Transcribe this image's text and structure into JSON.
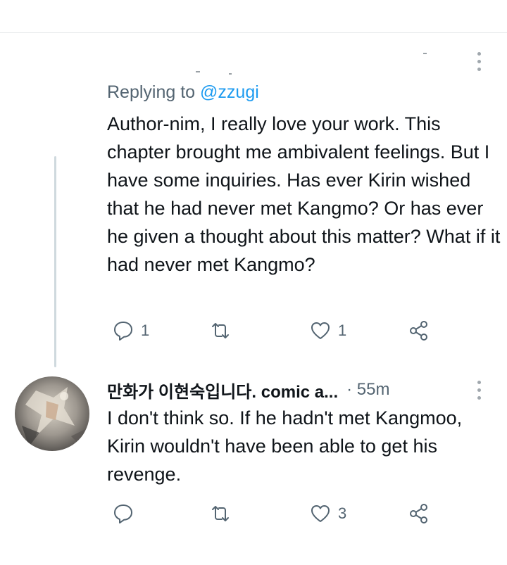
{
  "reply_tweet": {
    "replying_prefix": "Replying to",
    "replying_handle": "@zzugi",
    "text": "Author-nim, I really love your work. This chapter brought me ambivalent feelings. But I have some inquiries. Has ever Kirin wished that he had never met Kangmo? Or has ever he given a thought about this matter? What if it had never met Kangmo?",
    "replies": "1",
    "likes": "1",
    "icons": [
      "reply-icon",
      "retweet-icon",
      "like-icon",
      "share-icon",
      "more-icon"
    ]
  },
  "author_tweet": {
    "display_name": "만화가 이현숙입니다. comic a...",
    "time": "· 55m",
    "text": "I don't think so. If he hadn't met Kangmoo, Kirin wouldn't have been able to get his revenge.",
    "likes": "3",
    "icons": [
      "reply-icon",
      "retweet-icon",
      "like-icon",
      "share-icon",
      "more-icon"
    ]
  },
  "colors": {
    "link": "#1d9bf0",
    "secondary_text": "#536471",
    "thread_line": "#cfd9de",
    "divider": "#e7e9ea"
  }
}
